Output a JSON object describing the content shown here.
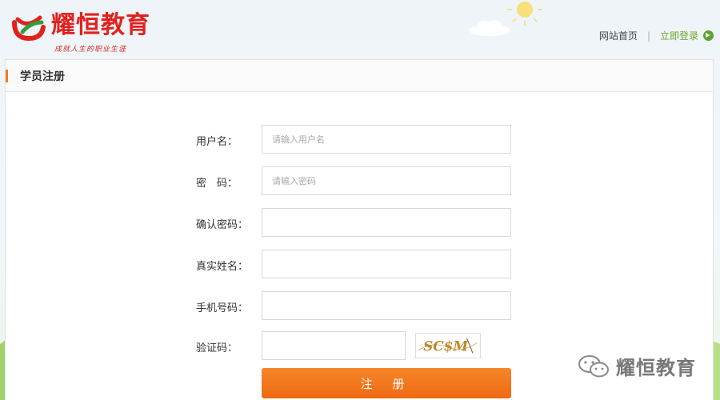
{
  "header": {
    "brand": "耀恒教育",
    "slogan": "成就人生的职业生涯",
    "links": {
      "home": "网站首页",
      "separator": "|",
      "login": "立即登录"
    }
  },
  "panel": {
    "title": "学员注册"
  },
  "form": {
    "fields": [
      {
        "label": "用户名：",
        "placeholder": "请输入用户名",
        "value": ""
      },
      {
        "label": "密　码：",
        "placeholder": "请输入密码",
        "value": ""
      },
      {
        "label": "确认密码：",
        "placeholder": "",
        "value": ""
      },
      {
        "label": "真实姓名：",
        "placeholder": "",
        "value": ""
      },
      {
        "label": "手机号码：",
        "placeholder": "",
        "value": ""
      },
      {
        "label": "验证码：",
        "placeholder": "",
        "value": ""
      }
    ],
    "captcha_text": "SC$M",
    "submit_label": "注 册"
  },
  "watermark": {
    "text": "耀恒教育",
    "icon": "wechat-icon"
  },
  "colors": {
    "brand_red": "#e0221e",
    "accent_orange": "#f07d1a",
    "button_orange": "#f26f15",
    "login_green": "#6aa52a"
  }
}
